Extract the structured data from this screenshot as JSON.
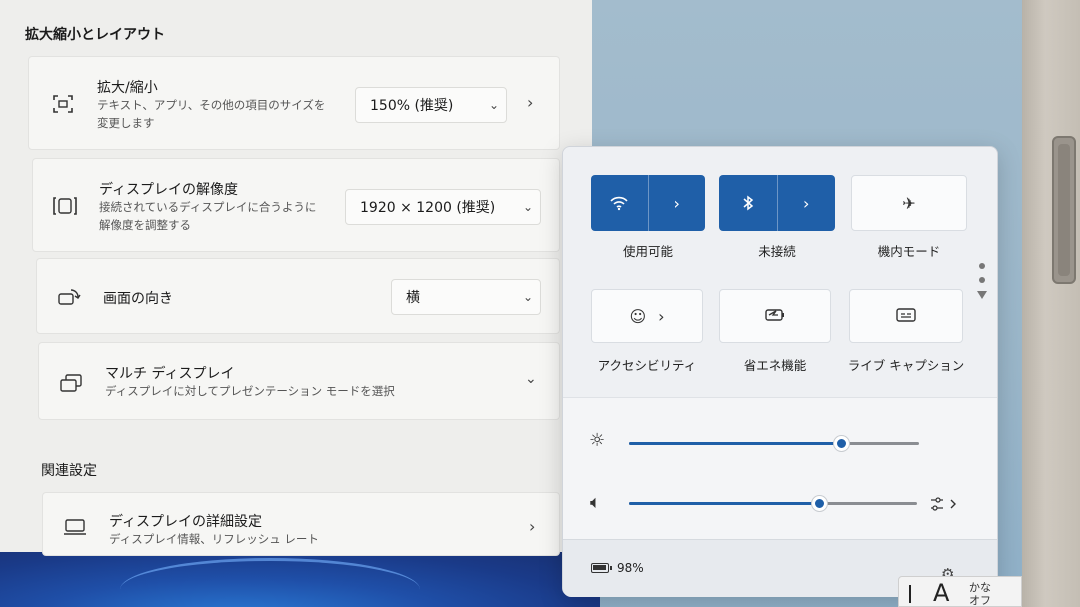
{
  "settings": {
    "section_scale_layout": "拡大縮小とレイアウト",
    "scale": {
      "title": "拡大/縮小",
      "desc_line1": "テキスト、アプリ、その他の項目のサイズを",
      "desc_line2": "変更します",
      "value": "150% (推奨)"
    },
    "resolution": {
      "title": "ディスプレイの解像度",
      "desc_line1": "接続されているディスプレイに合うように",
      "desc_line2": "解像度を調整する",
      "value": "1920 × 1200 (推奨)"
    },
    "orientation": {
      "title": "画面の向き",
      "value": "横"
    },
    "multi_display": {
      "title": "マルチ ディスプレイ",
      "desc": "ディスプレイに対してプレゼンテーション モードを選択"
    },
    "section_related": "関連設定",
    "advanced_display": {
      "title": "ディスプレイの詳細設定",
      "desc": "ディスプレイ情報、リフレッシュ レート"
    }
  },
  "quick_settings": {
    "tiles": [
      {
        "label": "使用可能",
        "icon": "wifi-icon",
        "state": "on"
      },
      {
        "label": "未接続",
        "icon": "bluetooth-icon",
        "state": "on"
      },
      {
        "label": "機内モード",
        "icon": "airplane-icon",
        "state": "off"
      },
      {
        "label": "アクセシビリティ",
        "icon": "accessibility-icon",
        "state": "off"
      },
      {
        "label": "省エネ機能",
        "icon": "energy-saver-icon",
        "state": "off"
      },
      {
        "label": "ライブ キャプション",
        "icon": "captions-icon",
        "state": "off"
      }
    ],
    "brightness_level": 0.73,
    "volume_level": 0.66,
    "battery_text": "98%",
    "battery_level": 0.98
  },
  "ime": {
    "mode_glyph": "A",
    "kana_line1": "かな",
    "kana_line2": "オフ"
  },
  "colors": {
    "accent": "#1f5fa8",
    "settings_bg": "#eeeeec",
    "card_bg": "#f6f6f4"
  }
}
